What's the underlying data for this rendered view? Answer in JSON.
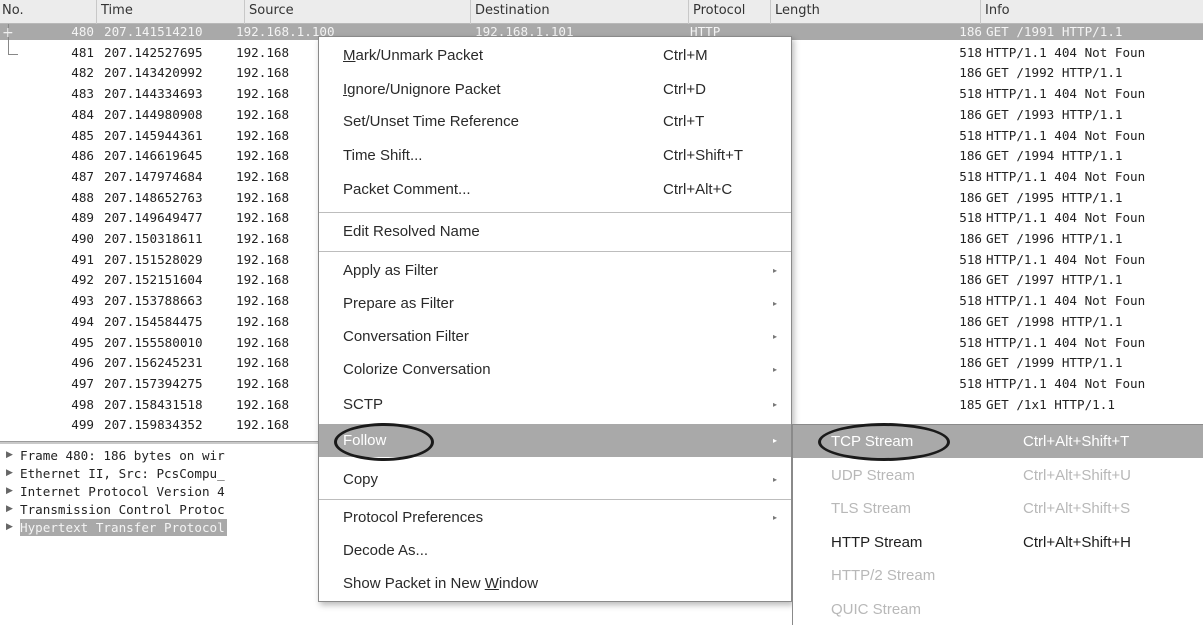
{
  "columns": {
    "no": "No.",
    "time": "Time",
    "source": "Source",
    "destination": "Destination",
    "protocol": "Protocol",
    "length": "Length",
    "info": "Info"
  },
  "packets": [
    {
      "no": "480",
      "time": "207.141514210",
      "src": "192.168.1.100",
      "dst": "192.168.1.101",
      "proto": "HTTP",
      "len": "186",
      "info": "GET /1991 HTTP/1.1"
    },
    {
      "no": "481",
      "time": "207.142527695",
      "src": "192.168",
      "dst": "",
      "proto": "",
      "len": "518",
      "info": "HTTP/1.1 404 Not Foun"
    },
    {
      "no": "482",
      "time": "207.143420992",
      "src": "192.168",
      "dst": "",
      "proto": "",
      "len": "186",
      "info": "GET /1992 HTTP/1.1"
    },
    {
      "no": "483",
      "time": "207.144334693",
      "src": "192.168",
      "dst": "",
      "proto": "",
      "len": "518",
      "info": "HTTP/1.1 404 Not Foun"
    },
    {
      "no": "484",
      "time": "207.144980908",
      "src": "192.168",
      "dst": "",
      "proto": "",
      "len": "186",
      "info": "GET /1993 HTTP/1.1"
    },
    {
      "no": "485",
      "time": "207.145944361",
      "src": "192.168",
      "dst": "",
      "proto": "",
      "len": "518",
      "info": "HTTP/1.1 404 Not Foun"
    },
    {
      "no": "486",
      "time": "207.146619645",
      "src": "192.168",
      "dst": "",
      "proto": "",
      "len": "186",
      "info": "GET /1994 HTTP/1.1"
    },
    {
      "no": "487",
      "time": "207.147974684",
      "src": "192.168",
      "dst": "",
      "proto": "",
      "len": "518",
      "info": "HTTP/1.1 404 Not Foun"
    },
    {
      "no": "488",
      "time": "207.148652763",
      "src": "192.168",
      "dst": "",
      "proto": "",
      "len": "186",
      "info": "GET /1995 HTTP/1.1"
    },
    {
      "no": "489",
      "time": "207.149649477",
      "src": "192.168",
      "dst": "",
      "proto": "",
      "len": "518",
      "info": "HTTP/1.1 404 Not Foun"
    },
    {
      "no": "490",
      "time": "207.150318611",
      "src": "192.168",
      "dst": "",
      "proto": "",
      "len": "186",
      "info": "GET /1996 HTTP/1.1"
    },
    {
      "no": "491",
      "time": "207.151528029",
      "src": "192.168",
      "dst": "",
      "proto": "",
      "len": "518",
      "info": "HTTP/1.1 404 Not Foun"
    },
    {
      "no": "492",
      "time": "207.152151604",
      "src": "192.168",
      "dst": "",
      "proto": "",
      "len": "186",
      "info": "GET /1997 HTTP/1.1"
    },
    {
      "no": "493",
      "time": "207.153788663",
      "src": "192.168",
      "dst": "",
      "proto": "",
      "len": "518",
      "info": "HTTP/1.1 404 Not Foun"
    },
    {
      "no": "494",
      "time": "207.154584475",
      "src": "192.168",
      "dst": "",
      "proto": "",
      "len": "186",
      "info": "GET /1998 HTTP/1.1"
    },
    {
      "no": "495",
      "time": "207.155580010",
      "src": "192.168",
      "dst": "",
      "proto": "",
      "len": "518",
      "info": "HTTP/1.1 404 Not Foun"
    },
    {
      "no": "496",
      "time": "207.156245231",
      "src": "192.168",
      "dst": "",
      "proto": "",
      "len": "186",
      "info": "GET /1999 HTTP/1.1"
    },
    {
      "no": "497",
      "time": "207.157394275",
      "src": "192.168",
      "dst": "",
      "proto": "",
      "len": "518",
      "info": "HTTP/1.1 404 Not Foun"
    },
    {
      "no": "498",
      "time": "207.158431518",
      "src": "192.168",
      "dst": "",
      "proto": "",
      "len": "185",
      "info": "GET /1x1 HTTP/1.1"
    },
    {
      "no": "499",
      "time": "207.159834352",
      "src": "192.168",
      "dst": "",
      "proto": "",
      "len": "",
      "info": ""
    }
  ],
  "details": [
    {
      "text": "Frame 480: 186 bytes on wir"
    },
    {
      "text": "Ethernet II, Src: PcsCompu_"
    },
    {
      "text": "Internet Protocol Version 4"
    },
    {
      "text": "Transmission Control Protoc"
    },
    {
      "text": "Hypertext Transfer Protocol"
    }
  ],
  "context_menu": {
    "mark": {
      "pre": "",
      "u": "M",
      "post": "ark/Unmark Packet",
      "shortcut": "Ctrl+M"
    },
    "ignore": {
      "pre": "",
      "u": "I",
      "post": "gnore/Unignore Packet",
      "shortcut": "Ctrl+D"
    },
    "time_ref": {
      "label": "Set/Unset Time Reference",
      "shortcut": "Ctrl+T"
    },
    "time_shift": {
      "label": "Time Shift...",
      "shortcut": "Ctrl+Shift+T"
    },
    "comment": {
      "label": "Packet Comment...",
      "shortcut": "Ctrl+Alt+C"
    },
    "edit_resolved": {
      "label": "Edit Resolved Name"
    },
    "apply_filter": {
      "label": "Apply as Filter"
    },
    "prepare_filter": {
      "label": "Prepare as Filter"
    },
    "conv_filter": {
      "label": "Conversation Filter"
    },
    "colorize": {
      "label": "Colorize Conversation"
    },
    "sctp": {
      "label": "SCTP"
    },
    "follow": {
      "label": "Follow"
    },
    "copy": {
      "label": "Copy"
    },
    "proto_prefs": {
      "label": "Protocol Preferences"
    },
    "decode_as": {
      "label": "Decode As..."
    },
    "new_window": {
      "pre": "Show Packet in New ",
      "u": "W",
      "post": "indow"
    },
    "submenu_arrow": "▸"
  },
  "follow_submenu": [
    {
      "label": "TCP Stream",
      "shortcut": "Ctrl+Alt+Shift+T",
      "state": "active"
    },
    {
      "label": "UDP Stream",
      "shortcut": "Ctrl+Alt+Shift+U",
      "state": "disabled"
    },
    {
      "label": "TLS Stream",
      "shortcut": "Ctrl+Alt+Shift+S",
      "state": "disabled"
    },
    {
      "label": "HTTP Stream",
      "shortcut": "Ctrl+Alt+Shift+H",
      "state": "enabled"
    },
    {
      "label": "HTTP/2 Stream",
      "shortcut": "",
      "state": "disabled"
    },
    {
      "label": "QUIC Stream",
      "shortcut": "",
      "state": "disabled"
    }
  ],
  "colors": {
    "selection": "#a9a9a9",
    "header_bg": "#ececec",
    "disabled_text": "#b8b8b8"
  },
  "icons": [
    "expand-plus-icon",
    "expand-arrow-icon",
    "submenu-arrow-icon"
  ]
}
